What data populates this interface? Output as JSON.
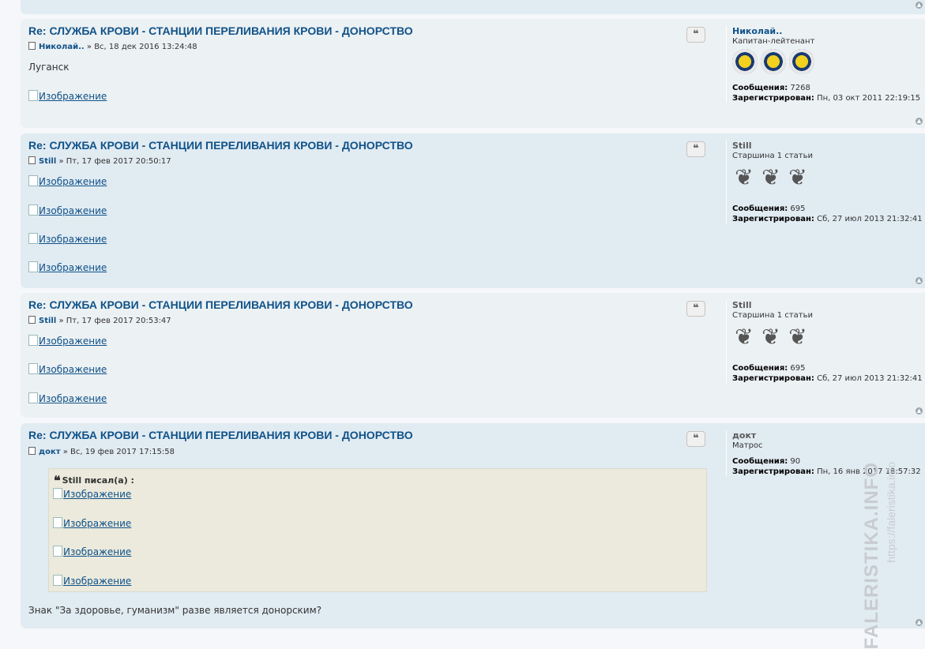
{
  "image_link_text": "Изображение",
  "top_fragment": "...",
  "posts": [
    {
      "title": "Re: СЛУЖБА КРОВИ - СТАНЦИИ ПЕРЕЛИВАНИЯ КРОВИ - ДОНОРСТВО",
      "author": "Николай..",
      "date": " » Вс, 18 дек 2016 13:24:48",
      "text": "Луганск",
      "quote_button": "❝",
      "profile": {
        "name": "Николай..",
        "rank": "Капитан-лейтенант",
        "messages_label": "Сообщения:",
        "messages": "7268",
        "registered_label": "Зарегистрирован:",
        "registered": "Пн, 03 окт 2011 22:19:15"
      }
    },
    {
      "title": "Re: СЛУЖБА КРОВИ - СТАНЦИИ ПЕРЕЛИВАНИЯ КРОВИ - ДОНОРСТВО",
      "author": "Still",
      "date": " » Пт, 17 фев 2017 20:50:17",
      "quote_button": "❝",
      "profile": {
        "name": "Still",
        "rank": "Старшина 1 статьи",
        "messages_label": "Сообщения:",
        "messages": "695",
        "registered_label": "Зарегистрирован:",
        "registered": "Сб, 27 июл 2013 21:32:41"
      }
    },
    {
      "title": "Re: СЛУЖБА КРОВИ - СТАНЦИИ ПЕРЕЛИВАНИЯ КРОВИ - ДОНОРСТВО",
      "author": "Still",
      "date": " » Пт, 17 фев 2017 20:53:47",
      "quote_button": "❝",
      "profile": {
        "name": "Still",
        "rank": "Старшина 1 статьи",
        "messages_label": "Сообщения:",
        "messages": "695",
        "registered_label": "Зарегистрирован:",
        "registered": "Сб, 27 июл 2013 21:32:41"
      }
    },
    {
      "title": "Re: СЛУЖБА КРОВИ - СТАНЦИИ ПЕРЕЛИВАНИЯ КРОВИ - ДОНОРСТВО",
      "author": "докт",
      "date": " » Вс, 19 фев 2017 17:15:58",
      "quote_author": "Still писал(а) :",
      "text": "Знак \"За здоровье, гуманизм\" разве является донорским?",
      "quote_button": "❝",
      "profile": {
        "name": "докт",
        "rank": "Матрос",
        "messages_label": "Сообщения:",
        "messages": "90",
        "registered_label": "Зарегистрирован:",
        "registered": "Пн, 16 янв 2017 18:57:32"
      }
    }
  ],
  "watermark": {
    "text": "FALERISTIKA.INFO",
    "url": "https://faleristika.info"
  }
}
